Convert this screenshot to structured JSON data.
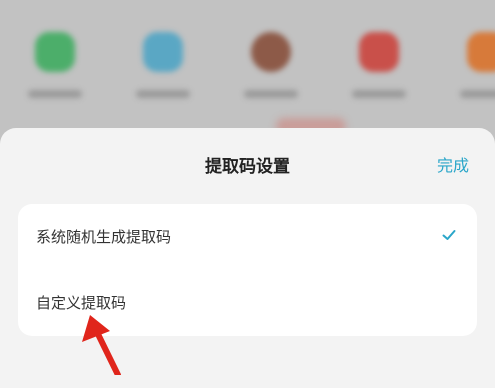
{
  "sheet": {
    "title": "提取码设置",
    "done_label": "完成"
  },
  "options": [
    {
      "label": "系统随机生成提取码",
      "selected": true
    },
    {
      "label": "自定义提取码",
      "selected": false
    }
  ],
  "colors": {
    "accent": "#2aa6c9",
    "annotation": "#e0251b",
    "sheet_bg": "#f3f3f3",
    "card_bg": "#ffffff"
  },
  "icons": {
    "selected_indicator": "check-icon"
  }
}
